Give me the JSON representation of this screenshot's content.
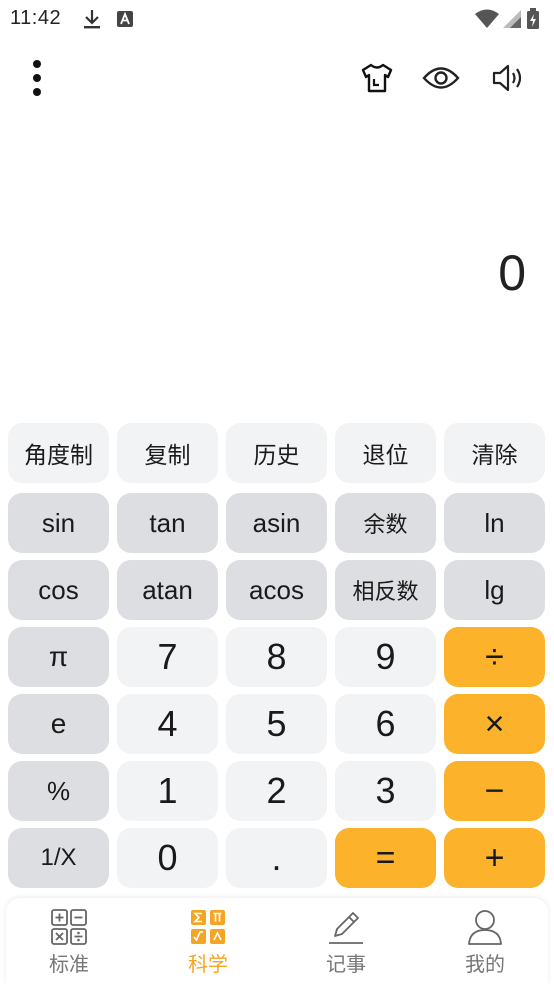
{
  "status_bar": {
    "time": "11:42",
    "icons": [
      "download-icon",
      "a-notification-icon",
      "wifi-icon",
      "signal-icon",
      "battery-icon"
    ]
  },
  "toolbar": {
    "icons": [
      "more-vert-icon",
      "theme-shirt-icon",
      "eye-icon",
      "volume-icon"
    ]
  },
  "display": {
    "value": "0"
  },
  "keypad": {
    "rows": [
      [
        "角度制",
        "复制",
        "历史",
        "退位",
        "清除"
      ],
      [
        "sin",
        "tan",
        "asin",
        "余数",
        "ln"
      ],
      [
        "cos",
        "atan",
        "acos",
        "相反数",
        "lg"
      ],
      [
        "π",
        "7",
        "8",
        "9",
        "÷"
      ],
      [
        "e",
        "4",
        "5",
        "6",
        "×"
      ],
      [
        "%",
        "1",
        "2",
        "3",
        "−"
      ],
      [
        "1/X",
        "0",
        ".",
        "=",
        "+"
      ]
    ]
  },
  "bottom_nav": {
    "items": [
      {
        "label": "标准",
        "icon": "standard-calculator-icon"
      },
      {
        "label": "科学",
        "icon": "scientific-calculator-icon"
      },
      {
        "label": "记事",
        "icon": "note-pencil-icon"
      },
      {
        "label": "我的",
        "icon": "profile-person-icon"
      }
    ],
    "active": "科学"
  },
  "colors": {
    "accent": "#fcb32b",
    "nav_active": "#f5a524",
    "key_light": "#f2f3f5",
    "key_gray": "#dcdee2"
  }
}
